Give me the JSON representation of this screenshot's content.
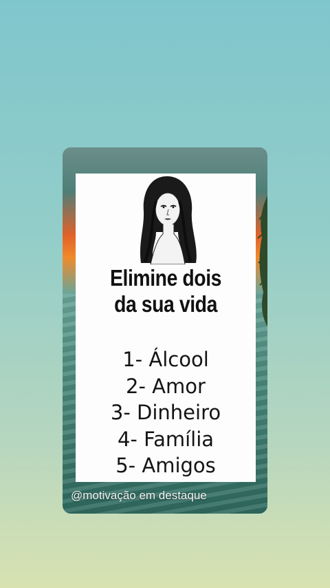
{
  "headline": {
    "line1": "Elimine dois",
    "line2": "da sua vida"
  },
  "options": [
    "1- Álcool",
    "2- Amor",
    "3- Dinheiro",
    "4- Família",
    "5- Amigos"
  ],
  "watermark": "@motivação em destaque",
  "colors": {
    "background_top": "#7fc6cc",
    "background_bottom": "#d8e2b1",
    "panel": "#fdfdfd",
    "text": "#111111",
    "sunset": "#f08a2a"
  },
  "icons": {
    "portrait": "woman-portrait-illustration"
  }
}
